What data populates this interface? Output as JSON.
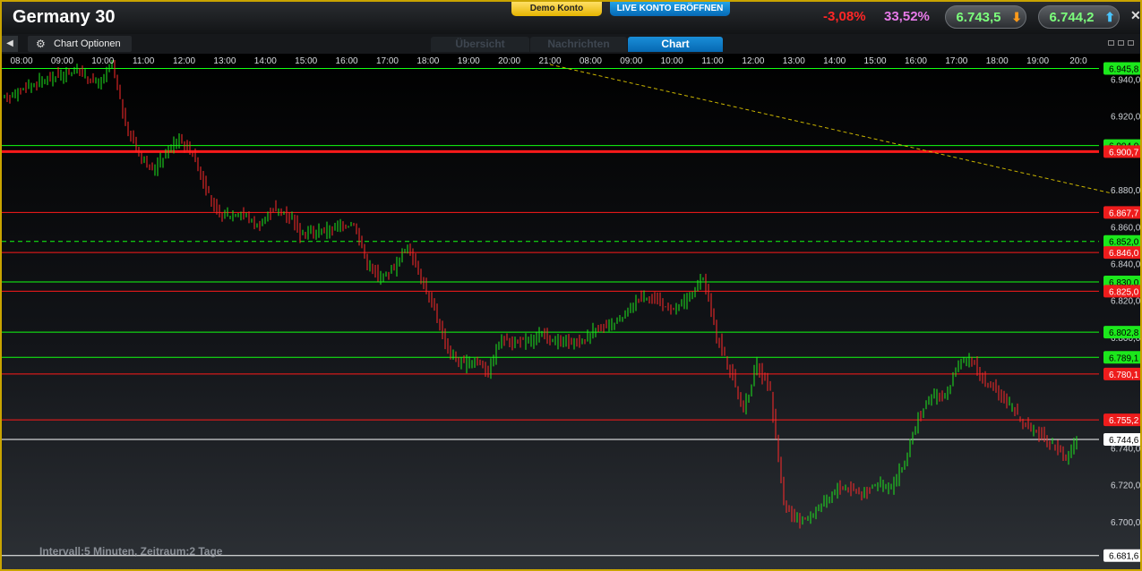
{
  "header": {
    "title": "Germany 30",
    "demo_label": "Demo Konto",
    "live_label": "LIVE KONTO ERÖFFNEN",
    "change_pct": "-3,08%",
    "other_pct": "33,52%",
    "sell_price": "6.743,5",
    "buy_price": "6.744,2",
    "close_icon": "close-icon"
  },
  "toolbar": {
    "chart_options_label": "Chart Optionen",
    "tabs": [
      {
        "label": "Übersicht",
        "active": false
      },
      {
        "label": "Nachrichten",
        "active": false
      },
      {
        "label": "Chart",
        "active": true
      }
    ]
  },
  "chart_info": "Intervall:5 Minuten, Zeitraum:2 Tage",
  "chart_data": {
    "type": "candlestick",
    "time_labels": [
      "08:00",
      "09:00",
      "10:00",
      "11:00",
      "12:00",
      "13:00",
      "14:00",
      "15:00",
      "16:00",
      "17:00",
      "18:00",
      "19:00",
      "20:00",
      "21:00",
      "08:00",
      "09:00",
      "10:00",
      "11:00",
      "12:00",
      "13:00",
      "14:00",
      "15:00",
      "16:00",
      "17:00",
      "18:00",
      "19:00",
      "20:0"
    ],
    "y_ticks": [
      "6.940,0",
      "6.920,0",
      "6.900,0",
      "6.880,0",
      "6.860,0",
      "6.840,0",
      "6.820,0",
      "6.800,0",
      "6.780,0",
      "6.740,0",
      "6.720,0",
      "6.700,0"
    ],
    "ylim": [
      6680,
      6948
    ],
    "levels": [
      {
        "label": "6.945,8",
        "value": 6945.8,
        "color": "#12ff12",
        "style": "solid"
      },
      {
        "label": "6.904,0",
        "value": 6904.0,
        "color": "#12ff12",
        "style": "solid"
      },
      {
        "label": "6.900,7",
        "value": 6900.7,
        "color": "#ff1a1a",
        "style": "thick"
      },
      {
        "label": "6.867,7",
        "value": 6867.7,
        "color": "#ff1a1a",
        "style": "solid"
      },
      {
        "label": "6.852,0",
        "value": 6852.0,
        "color": "#12ff12",
        "style": "dashed"
      },
      {
        "label": "6.846,0",
        "value": 6846.0,
        "color": "#ff1a1a",
        "style": "solid"
      },
      {
        "label": "6.830,0",
        "value": 6830.0,
        "color": "#12ff12",
        "style": "solid"
      },
      {
        "label": "6.825,0",
        "value": 6825.0,
        "color": "#ff1a1a",
        "style": "solid"
      },
      {
        "label": "6.802,8",
        "value": 6802.8,
        "color": "#12ff12",
        "style": "solid"
      },
      {
        "label": "6.789,1",
        "value": 6789.1,
        "color": "#12ff12",
        "style": "solid"
      },
      {
        "label": "6.780,1",
        "value": 6780.1,
        "color": "#ff1a1a",
        "style": "solid"
      },
      {
        "label": "6.755,2",
        "value": 6755.2,
        "color": "#ff1a1a",
        "style": "solid"
      },
      {
        "label": "6.744,6",
        "value": 6744.6,
        "color": "#ffffff",
        "style": "current"
      },
      {
        "label": "6.681,6",
        "value": 6681.6,
        "color": "#ffffff",
        "style": "solid"
      }
    ],
    "trendline": {
      "from": {
        "time": "21:00",
        "value": 6948
      },
      "to": {
        "time": "20:0",
        "value": 6878
      },
      "color": "#c9b400"
    },
    "price_path": [
      [
        0,
        6930
      ],
      [
        3,
        6940
      ],
      [
        5.5,
        6945
      ],
      [
        7,
        6937
      ],
      [
        8,
        6948
      ],
      [
        9,
        6915
      ],
      [
        10,
        6900
      ],
      [
        11,
        6890
      ],
      [
        12,
        6900
      ],
      [
        13,
        6908
      ],
      [
        14,
        6900
      ],
      [
        15,
        6880
      ],
      [
        16,
        6865
      ],
      [
        17.5,
        6868
      ],
      [
        19,
        6860
      ],
      [
        20,
        6870
      ],
      [
        21.5,
        6865
      ],
      [
        22,
        6856
      ],
      [
        24,
        6858
      ],
      [
        26,
        6862
      ],
      [
        27,
        6840
      ],
      [
        28,
        6832
      ],
      [
        29,
        6838
      ],
      [
        30,
        6850
      ],
      [
        31,
        6832
      ],
      [
        32,
        6815
      ],
      [
        33,
        6792
      ],
      [
        34,
        6785
      ],
      [
        35,
        6788
      ],
      [
        36,
        6782
      ],
      [
        37,
        6800
      ],
      [
        38,
        6797
      ],
      [
        39,
        6798
      ],
      [
        40,
        6802
      ],
      [
        41,
        6797
      ],
      [
        43,
        6798
      ],
      [
        44,
        6805
      ],
      [
        45,
        6805
      ],
      [
        46,
        6810
      ],
      [
        47,
        6820
      ],
      [
        48,
        6823
      ],
      [
        49,
        6817
      ],
      [
        50,
        6815
      ],
      [
        51,
        6822
      ],
      [
        52,
        6832
      ],
      [
        52.5,
        6818
      ],
      [
        53,
        6801
      ],
      [
        54,
        6782
      ],
      [
        55,
        6760
      ],
      [
        56,
        6785
      ],
      [
        57,
        6770
      ],
      [
        57.3,
        6752
      ],
      [
        58,
        6710
      ],
      [
        59,
        6700
      ],
      [
        60,
        6703
      ],
      [
        61,
        6710
      ],
      [
        62,
        6718
      ],
      [
        63,
        6718
      ],
      [
        64,
        6715
      ],
      [
        65,
        6722
      ],
      [
        66,
        6718
      ],
      [
        67,
        6732
      ],
      [
        68,
        6755
      ],
      [
        69,
        6768
      ],
      [
        70,
        6768
      ],
      [
        71,
        6785
      ],
      [
        72,
        6788
      ],
      [
        73,
        6775
      ],
      [
        74,
        6770
      ],
      [
        75,
        6762
      ],
      [
        76,
        6752
      ],
      [
        77,
        6748
      ],
      [
        78,
        6742
      ],
      [
        79,
        6735
      ],
      [
        80,
        6744.6
      ]
    ]
  }
}
